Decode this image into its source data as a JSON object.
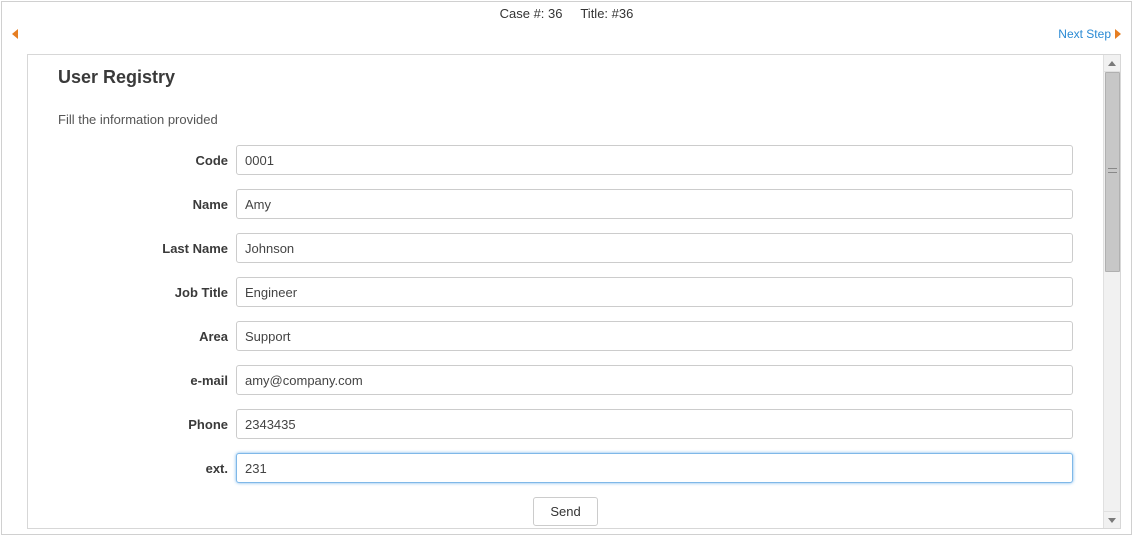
{
  "header": {
    "case_label": "Case #:",
    "case_value": "36",
    "title_label": "Title:",
    "title_value": "#36"
  },
  "nav": {
    "next_step_label": "Next Step"
  },
  "form": {
    "title": "User Registry",
    "subtitle": "Fill the information provided",
    "fields": {
      "code": {
        "label": "Code",
        "value": "0001"
      },
      "name": {
        "label": "Name",
        "value": "Amy"
      },
      "lastname": {
        "label": "Last Name",
        "value": "Johnson"
      },
      "jobtitle": {
        "label": "Job Title",
        "value": "Engineer"
      },
      "area": {
        "label": "Area",
        "value": "Support"
      },
      "email": {
        "label": "e-mail",
        "value": "amy@company.com"
      },
      "phone": {
        "label": "Phone",
        "value": "2343435"
      },
      "ext": {
        "label": "ext.",
        "value": "231"
      }
    },
    "submit_label": "Send"
  }
}
